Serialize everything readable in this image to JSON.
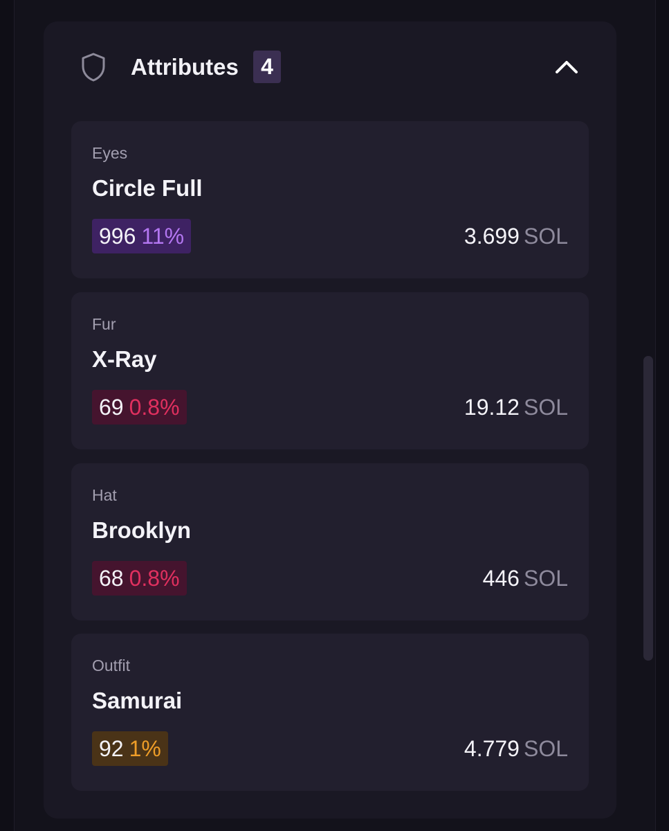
{
  "header": {
    "title": "Attributes",
    "count": "4",
    "icon": "shield-icon",
    "toggle_icon": "chevron-up-icon"
  },
  "attributes": [
    {
      "trait": "Eyes",
      "value": "Circle Full",
      "count": "996",
      "percent": "11%",
      "price": "3.699",
      "currency": "SOL",
      "badge_bg": "#3e2263",
      "percent_color": "#b477f2"
    },
    {
      "trait": "Fur",
      "value": "X-Ray",
      "count": "69",
      "percent": "0.8%",
      "price": "19.12",
      "currency": "SOL",
      "badge_bg": "#45142e",
      "percent_color": "#e0305f"
    },
    {
      "trait": "Hat",
      "value": "Brooklyn",
      "count": "68",
      "percent": "0.8%",
      "price": "446",
      "currency": "SOL",
      "badge_bg": "#45142e",
      "percent_color": "#e0305f"
    },
    {
      "trait": "Outfit",
      "value": "Samurai",
      "count": "92",
      "percent": "1%",
      "price": "4.779",
      "currency": "SOL",
      "badge_bg": "#4a3317",
      "percent_color": "#ee9d28"
    }
  ]
}
